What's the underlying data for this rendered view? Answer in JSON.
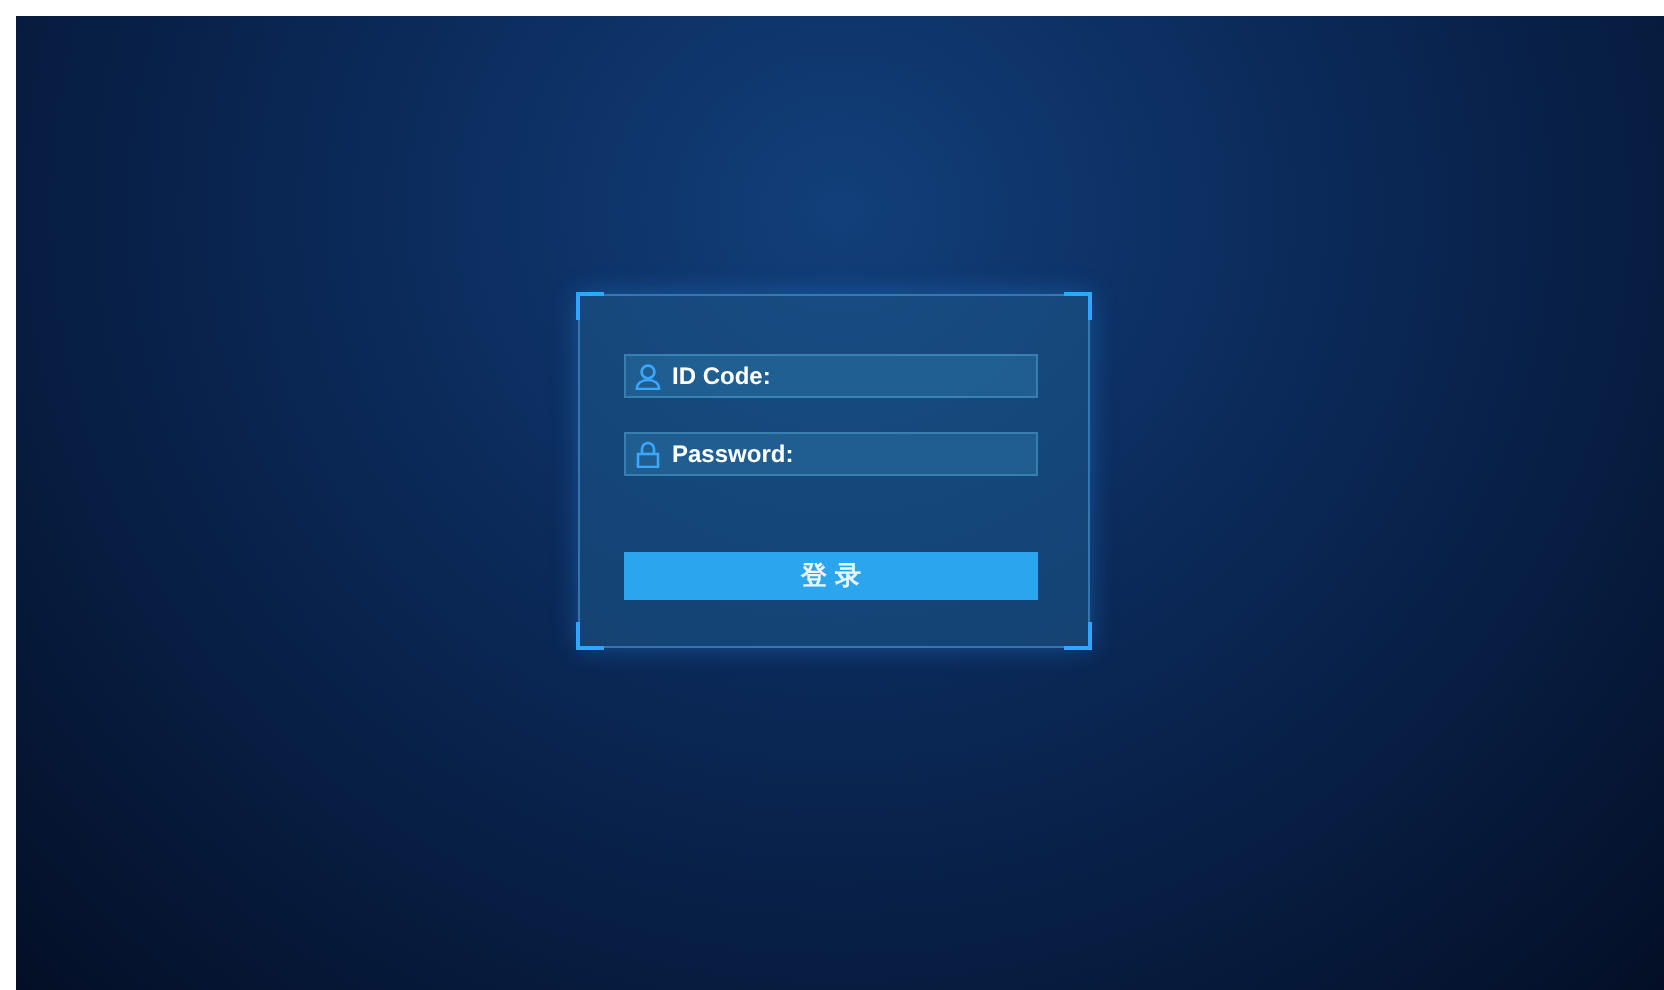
{
  "login_form": {
    "fields": [
      {
        "kind": "user",
        "label": "ID Code:"
      },
      {
        "kind": "lock",
        "label": "Password:"
      }
    ],
    "submit_button": "登 录"
  }
}
